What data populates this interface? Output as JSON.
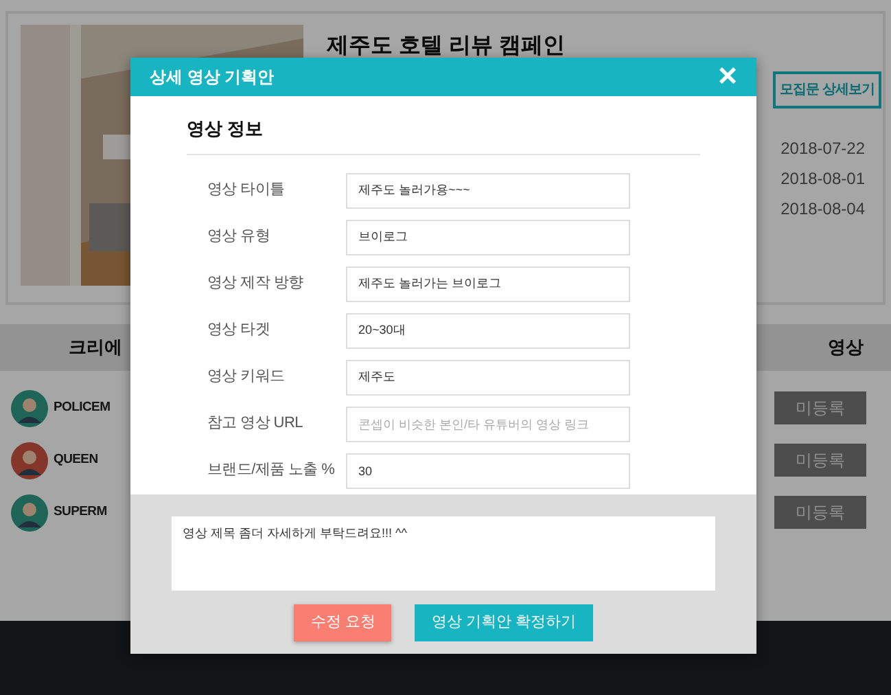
{
  "campaign": {
    "title": "제주도 호텔 리뷰 캠페인",
    "detail_button": "모집문 상세보기",
    "dates": [
      "2018-07-22",
      "2018-08-01",
      "2018-08-04"
    ]
  },
  "table": {
    "columns": [
      "크리에",
      "영상"
    ],
    "rows": [
      {
        "name": "POLICEM",
        "status": "미등록"
      },
      {
        "name": "QUEEN",
        "status": "미등록"
      },
      {
        "name": "SUPERM",
        "status": "미등록"
      }
    ]
  },
  "modal": {
    "title": "상세 영상 기획안",
    "close": "×",
    "section": "영상 정보",
    "fields": [
      {
        "label": "영상 타이틀",
        "value": "제주도 놀러가용~~~"
      },
      {
        "label": "영상 유형",
        "value": "브이로그"
      },
      {
        "label": "영상 제작 방향",
        "value": "제주도 놀러가는 브이로그"
      },
      {
        "label": "영상 타겟",
        "value": "20~30대"
      },
      {
        "label": "영상 키워드",
        "value": "제주도"
      },
      {
        "label": "참고 영상 URL",
        "placeholder": "콘셉이 비슷한 본인/타 유튜버의 영상 링크"
      },
      {
        "label": "브랜드/제품 노출 %",
        "value": "30"
      }
    ],
    "comment": "영상 제목 좀더 자세하게 부탁드려요!!! ^^",
    "buttons": [
      {
        "label": "수정 요청",
        "kind": "request"
      },
      {
        "label": "영상 기획안 확정하기",
        "kind": "confirm"
      }
    ]
  }
}
